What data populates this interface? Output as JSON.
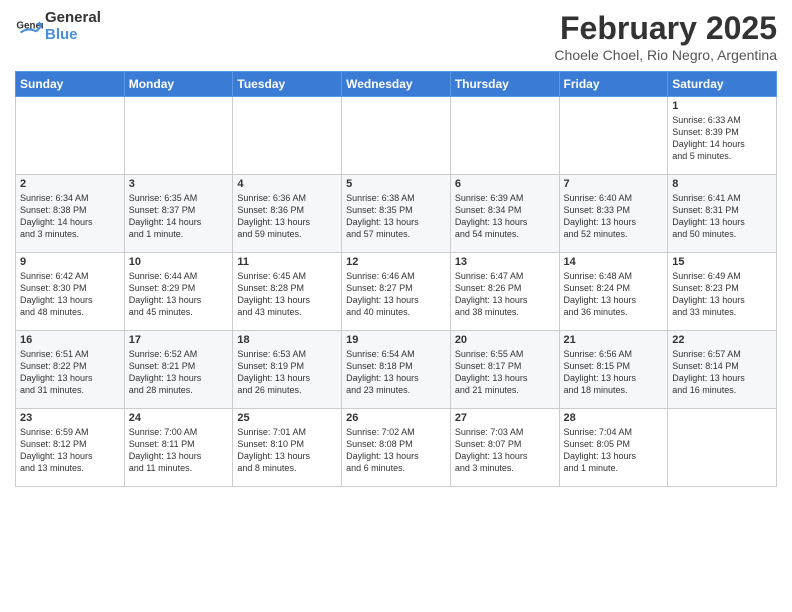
{
  "header": {
    "logo_general": "General",
    "logo_blue": "Blue",
    "month_title": "February 2025",
    "location": "Choele Choel, Rio Negro, Argentina"
  },
  "days_of_week": [
    "Sunday",
    "Monday",
    "Tuesday",
    "Wednesday",
    "Thursday",
    "Friday",
    "Saturday"
  ],
  "weeks": [
    [
      {
        "day": "",
        "info": ""
      },
      {
        "day": "",
        "info": ""
      },
      {
        "day": "",
        "info": ""
      },
      {
        "day": "",
        "info": ""
      },
      {
        "day": "",
        "info": ""
      },
      {
        "day": "",
        "info": ""
      },
      {
        "day": "1",
        "info": "Sunrise: 6:33 AM\nSunset: 8:39 PM\nDaylight: 14 hours\nand 5 minutes."
      }
    ],
    [
      {
        "day": "2",
        "info": "Sunrise: 6:34 AM\nSunset: 8:38 PM\nDaylight: 14 hours\nand 3 minutes."
      },
      {
        "day": "3",
        "info": "Sunrise: 6:35 AM\nSunset: 8:37 PM\nDaylight: 14 hours\nand 1 minute."
      },
      {
        "day": "4",
        "info": "Sunrise: 6:36 AM\nSunset: 8:36 PM\nDaylight: 13 hours\nand 59 minutes."
      },
      {
        "day": "5",
        "info": "Sunrise: 6:38 AM\nSunset: 8:35 PM\nDaylight: 13 hours\nand 57 minutes."
      },
      {
        "day": "6",
        "info": "Sunrise: 6:39 AM\nSunset: 8:34 PM\nDaylight: 13 hours\nand 54 minutes."
      },
      {
        "day": "7",
        "info": "Sunrise: 6:40 AM\nSunset: 8:33 PM\nDaylight: 13 hours\nand 52 minutes."
      },
      {
        "day": "8",
        "info": "Sunrise: 6:41 AM\nSunset: 8:31 PM\nDaylight: 13 hours\nand 50 minutes."
      }
    ],
    [
      {
        "day": "9",
        "info": "Sunrise: 6:42 AM\nSunset: 8:30 PM\nDaylight: 13 hours\nand 48 minutes."
      },
      {
        "day": "10",
        "info": "Sunrise: 6:44 AM\nSunset: 8:29 PM\nDaylight: 13 hours\nand 45 minutes."
      },
      {
        "day": "11",
        "info": "Sunrise: 6:45 AM\nSunset: 8:28 PM\nDaylight: 13 hours\nand 43 minutes."
      },
      {
        "day": "12",
        "info": "Sunrise: 6:46 AM\nSunset: 8:27 PM\nDaylight: 13 hours\nand 40 minutes."
      },
      {
        "day": "13",
        "info": "Sunrise: 6:47 AM\nSunset: 8:26 PM\nDaylight: 13 hours\nand 38 minutes."
      },
      {
        "day": "14",
        "info": "Sunrise: 6:48 AM\nSunset: 8:24 PM\nDaylight: 13 hours\nand 36 minutes."
      },
      {
        "day": "15",
        "info": "Sunrise: 6:49 AM\nSunset: 8:23 PM\nDaylight: 13 hours\nand 33 minutes."
      }
    ],
    [
      {
        "day": "16",
        "info": "Sunrise: 6:51 AM\nSunset: 8:22 PM\nDaylight: 13 hours\nand 31 minutes."
      },
      {
        "day": "17",
        "info": "Sunrise: 6:52 AM\nSunset: 8:21 PM\nDaylight: 13 hours\nand 28 minutes."
      },
      {
        "day": "18",
        "info": "Sunrise: 6:53 AM\nSunset: 8:19 PM\nDaylight: 13 hours\nand 26 minutes."
      },
      {
        "day": "19",
        "info": "Sunrise: 6:54 AM\nSunset: 8:18 PM\nDaylight: 13 hours\nand 23 minutes."
      },
      {
        "day": "20",
        "info": "Sunrise: 6:55 AM\nSunset: 8:17 PM\nDaylight: 13 hours\nand 21 minutes."
      },
      {
        "day": "21",
        "info": "Sunrise: 6:56 AM\nSunset: 8:15 PM\nDaylight: 13 hours\nand 18 minutes."
      },
      {
        "day": "22",
        "info": "Sunrise: 6:57 AM\nSunset: 8:14 PM\nDaylight: 13 hours\nand 16 minutes."
      }
    ],
    [
      {
        "day": "23",
        "info": "Sunrise: 6:59 AM\nSunset: 8:12 PM\nDaylight: 13 hours\nand 13 minutes."
      },
      {
        "day": "24",
        "info": "Sunrise: 7:00 AM\nSunset: 8:11 PM\nDaylight: 13 hours\nand 11 minutes."
      },
      {
        "day": "25",
        "info": "Sunrise: 7:01 AM\nSunset: 8:10 PM\nDaylight: 13 hours\nand 8 minutes."
      },
      {
        "day": "26",
        "info": "Sunrise: 7:02 AM\nSunset: 8:08 PM\nDaylight: 13 hours\nand 6 minutes."
      },
      {
        "day": "27",
        "info": "Sunrise: 7:03 AM\nSunset: 8:07 PM\nDaylight: 13 hours\nand 3 minutes."
      },
      {
        "day": "28",
        "info": "Sunrise: 7:04 AM\nSunset: 8:05 PM\nDaylight: 13 hours\nand 1 minute."
      },
      {
        "day": "",
        "info": ""
      }
    ]
  ]
}
